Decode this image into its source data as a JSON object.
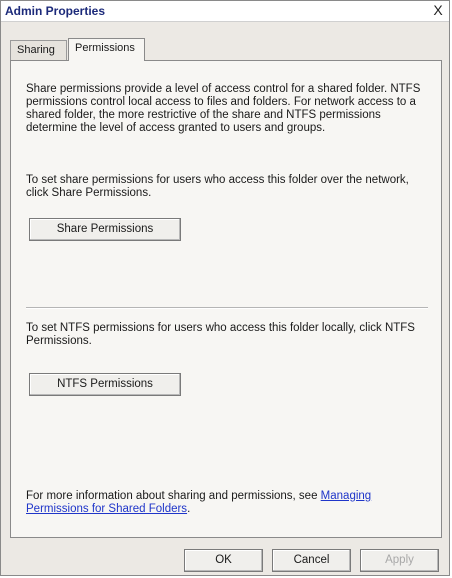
{
  "window": {
    "title": "Admin Properties",
    "close_label": "X"
  },
  "tabs": [
    {
      "label": "Sharing",
      "selected": false
    },
    {
      "label": "Permissions",
      "selected": true
    }
  ],
  "panel": {
    "intro": "Share permissions provide a level of access control for a shared folder. NTFS permissions control local access to files and folders. For network access to a shared folder, the more restrictive of the share and NTFS permissions determine the level of access granted to users and groups.",
    "share_instructions": "To set share permissions for users who access this folder over the network, click Share Permissions.",
    "share_button": "Share Permissions",
    "ntfs_instructions": "To set NTFS permissions for users who access this folder locally, click NTFS Permissions.",
    "ntfs_button": "NTFS Permissions",
    "more_info_prefix": "For more information about sharing and permissions, see ",
    "more_info_link": "Managing Permissions for Shared Folders",
    "more_info_suffix": "."
  },
  "footer": {
    "ok": "OK",
    "cancel": "Cancel",
    "apply": "Apply",
    "apply_enabled": false
  }
}
